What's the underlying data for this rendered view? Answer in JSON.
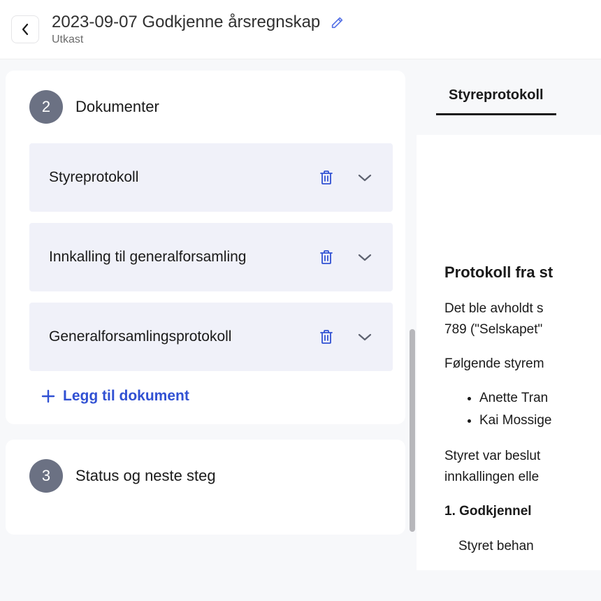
{
  "header": {
    "title": "2023-09-07 Godkjenne årsregnskap",
    "status": "Utkast"
  },
  "left": {
    "documents": {
      "step_number": "2",
      "title": "Dokumenter",
      "items": [
        {
          "name": "Styreprotokoll"
        },
        {
          "name": "Innkalling til generalforsamling"
        },
        {
          "name": "Generalforsamlingsprotokoll"
        }
      ],
      "add_label": "Legg til dokument"
    },
    "status_step": {
      "step_number": "3",
      "title": "Status og neste steg"
    }
  },
  "right": {
    "tab_label": "Styreprotokoll",
    "preview": {
      "heading": "Protokoll fra st",
      "para1": "Det ble avholdt s",
      "para1b": "789 (\"Selskapet\"",
      "para2": "Følgende styrem",
      "members": [
        "Anette Tran",
        "Kai Mossige"
      ],
      "para3": "Styret var beslut",
      "para3b": "innkallingen elle",
      "ol1": "1.   Godkjennel",
      "ol1_body": "Styret behan"
    }
  }
}
